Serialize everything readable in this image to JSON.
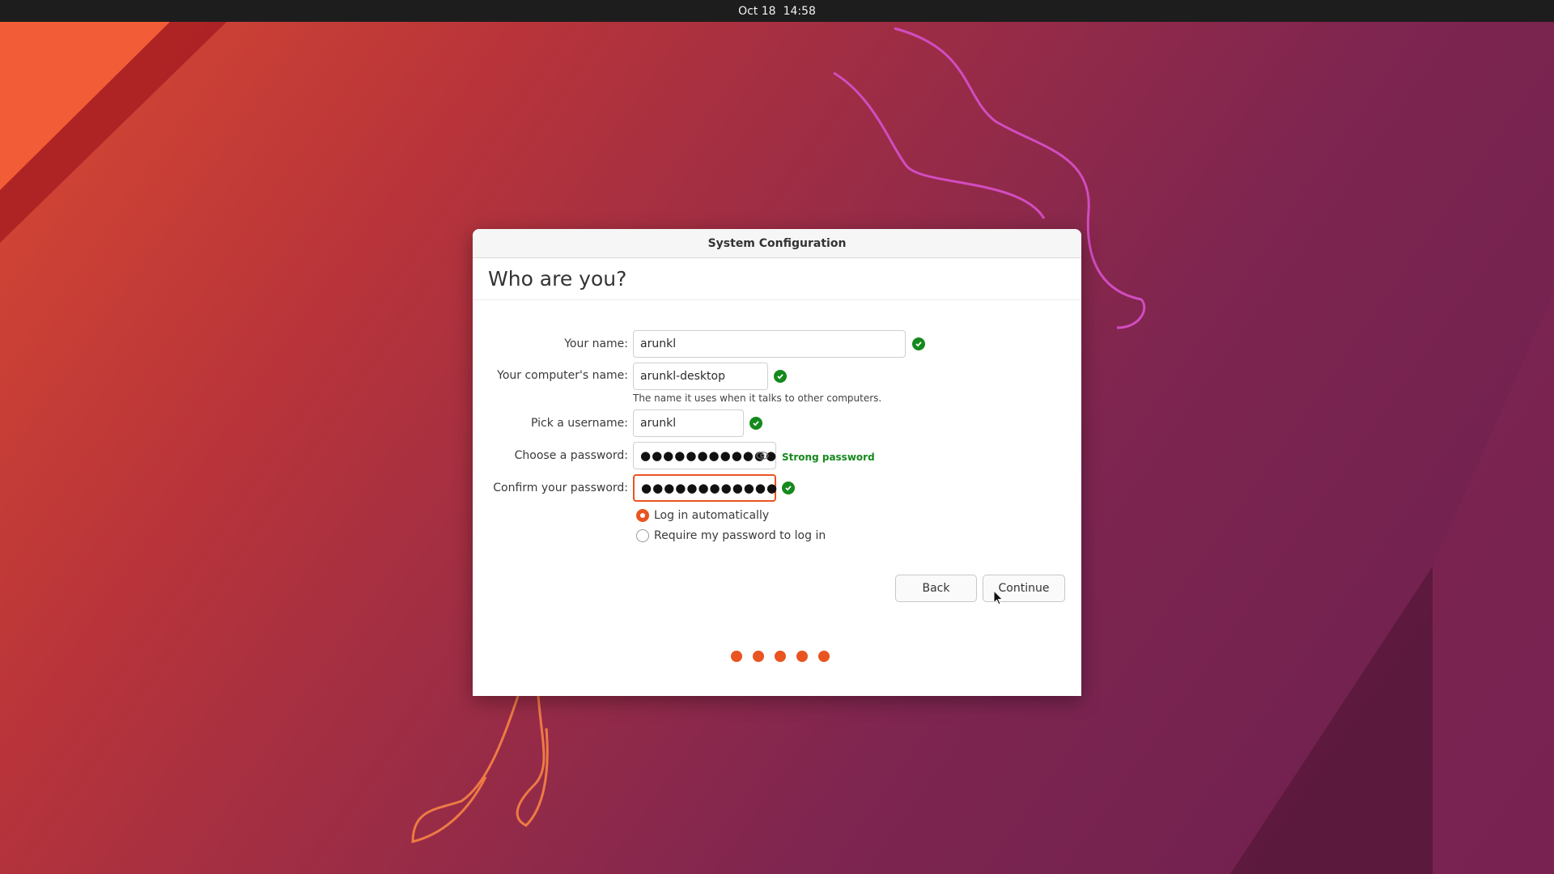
{
  "topbar": {
    "date": "Oct 18",
    "time": "14:58"
  },
  "dialog": {
    "title": "System Configuration",
    "heading": "Who are you?",
    "fields": {
      "name": {
        "label": "Your name:",
        "value": "arunkl"
      },
      "computer": {
        "label": "Your computer's name:",
        "value": "arunkl-desktop",
        "hint": "The name it uses when it talks to other computers."
      },
      "username": {
        "label": "Pick a username:",
        "value": "arunkl"
      },
      "password": {
        "label": "Choose a password:",
        "value": "●●●●●●●●●●●●",
        "strength": "Strong password"
      },
      "confirm": {
        "label": "Confirm your password:",
        "value": "●●●●●●●●●●●●"
      }
    },
    "login_options": {
      "auto": "Log in automatically",
      "require": "Require my password to log in",
      "selected": "auto"
    },
    "buttons": {
      "back": "Back",
      "continue": "Continue"
    },
    "progress": {
      "total_steps": 5,
      "completed_steps": 5
    }
  },
  "colors": {
    "accent": "#E95420",
    "success": "#15891D",
    "topbar": "#1D1D1D"
  },
  "icons": [
    "check-icon",
    "eye-icon",
    "mouse-cursor-icon"
  ]
}
